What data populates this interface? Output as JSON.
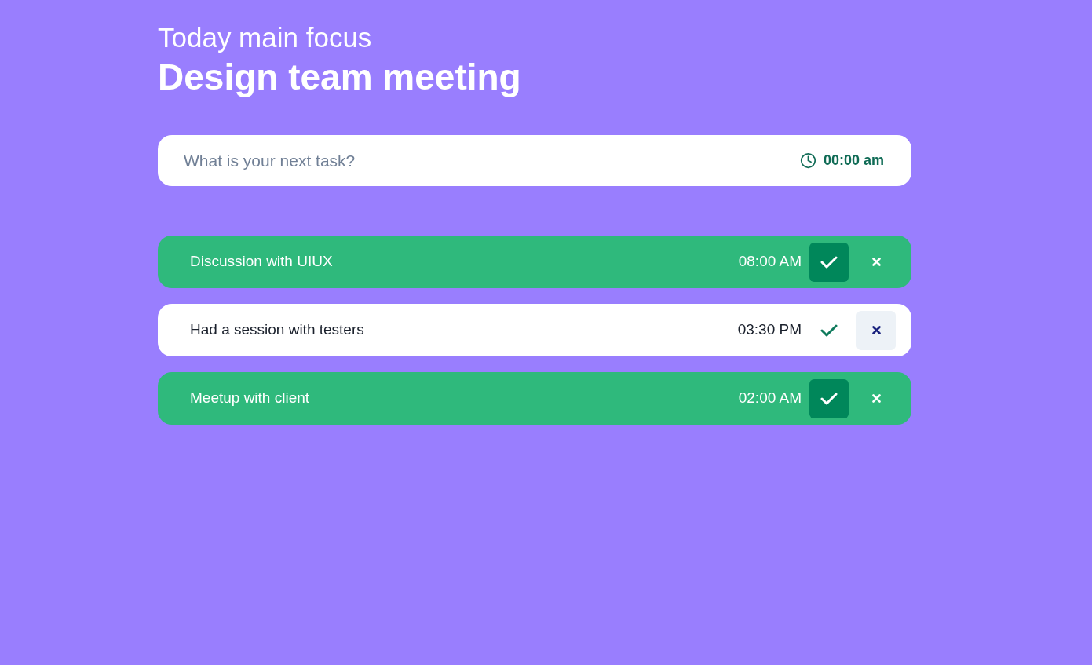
{
  "subtitle": "Today main focus",
  "focus": "Design team meeting",
  "new_task": {
    "placeholder": "What is your next task?",
    "time": "00:00 am"
  },
  "tasks": [
    {
      "text": "Discussion with UIUX",
      "time": "08:00 AM",
      "done": true
    },
    {
      "text": "Had a session with testers",
      "time": "03:30 PM",
      "done": false
    },
    {
      "text": "Meetup with client",
      "time": "02:00 AM",
      "done": true
    }
  ]
}
